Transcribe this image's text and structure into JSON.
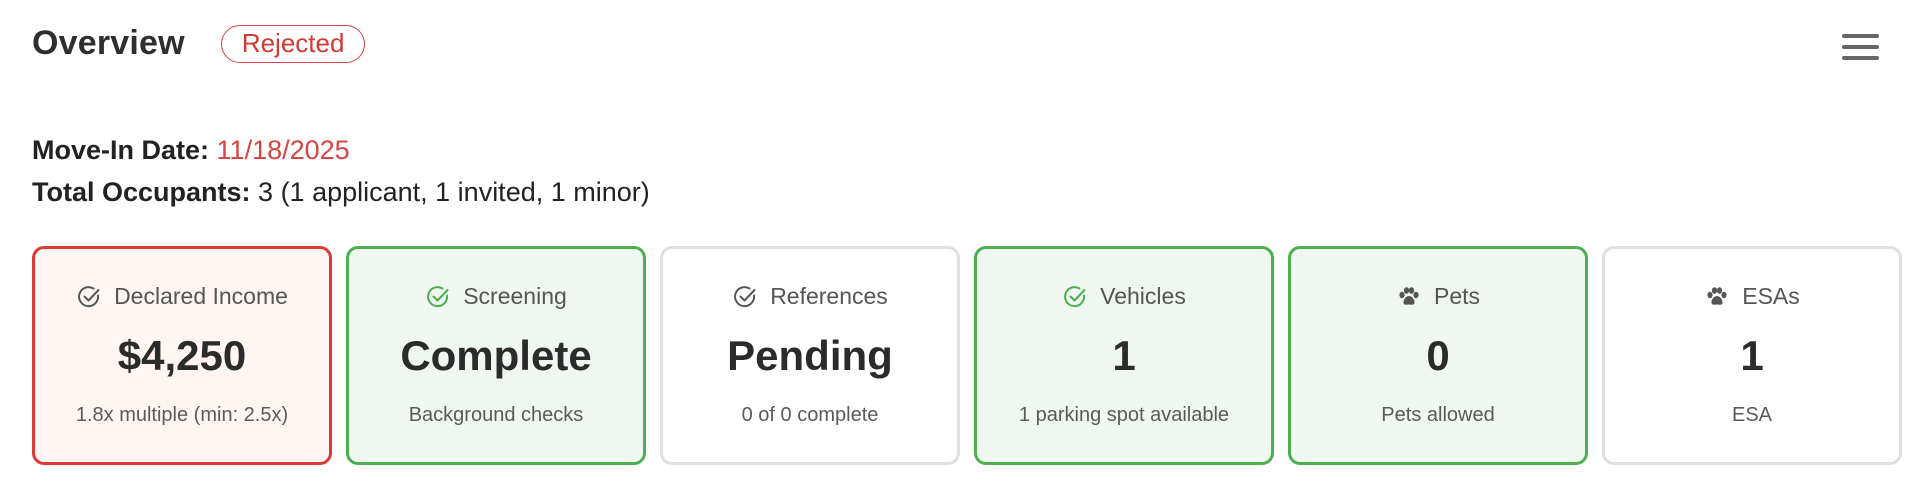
{
  "header": {
    "title": "Overview",
    "status": "Rejected"
  },
  "info": {
    "move_in_label": "Move-In Date:",
    "move_in_value": "11/18/2025",
    "occupants_label": "Total Occupants:",
    "occupants_value": "3 (1 applicant, 1 invited, 1 minor)"
  },
  "cards": [
    {
      "title": "Declared Income",
      "value": "$4,250",
      "sub": "1.8x multiple (min: 2.5x)",
      "icon": "check-circle-icon",
      "state": "danger"
    },
    {
      "title": "Screening",
      "value": "Complete",
      "sub": "Background checks",
      "icon": "check-circle-icon",
      "state": "success"
    },
    {
      "title": "References",
      "value": "Pending",
      "sub": "0 of 0 complete",
      "icon": "check-circle-icon",
      "state": "neutral"
    },
    {
      "title": "Vehicles",
      "value": "1",
      "sub": "1 parking spot available",
      "icon": "check-circle-icon",
      "state": "success"
    },
    {
      "title": "Pets",
      "value": "0",
      "sub": "Pets allowed",
      "icon": "paw-icon",
      "state": "success"
    },
    {
      "title": "ESAs",
      "value": "1",
      "sub": "ESA",
      "icon": "paw-icon",
      "state": "neutral"
    }
  ],
  "colors": {
    "danger": "#de3b35",
    "success": "#4caf50",
    "neutral": "#e0e0e0",
    "danger_bg": "#fff6f4",
    "success_bg": "#f0f7f1"
  }
}
